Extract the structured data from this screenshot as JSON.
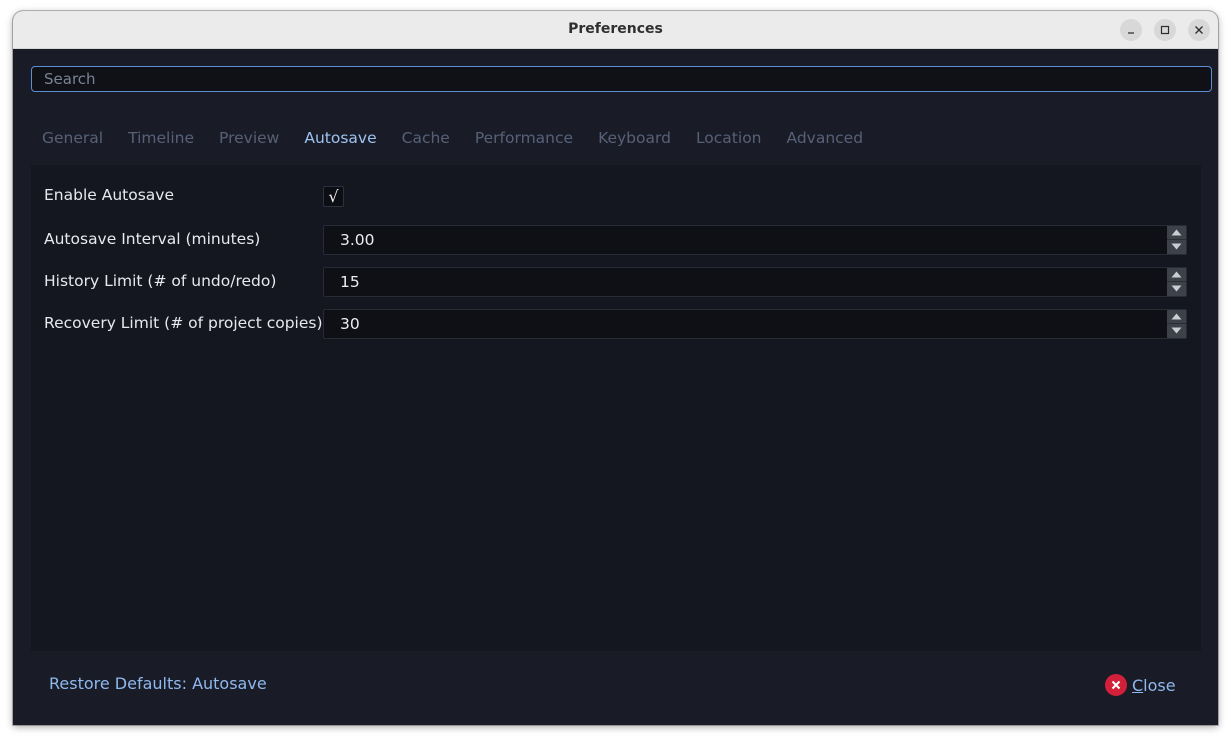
{
  "window": {
    "title": "Preferences",
    "controls": [
      "minimize-icon",
      "maximize-icon",
      "close-icon"
    ]
  },
  "search": {
    "placeholder": "Search",
    "value": ""
  },
  "tabs": [
    {
      "label": "General",
      "active": false
    },
    {
      "label": "Timeline",
      "active": false
    },
    {
      "label": "Preview",
      "active": false
    },
    {
      "label": "Autosave",
      "active": true
    },
    {
      "label": "Cache",
      "active": false
    },
    {
      "label": "Performance",
      "active": false
    },
    {
      "label": "Keyboard",
      "active": false
    },
    {
      "label": "Location",
      "active": false
    },
    {
      "label": "Advanced",
      "active": false
    }
  ],
  "settings": {
    "enable_autosave": {
      "label": "Enable Autosave",
      "checked": true,
      "check_glyph": "√"
    },
    "autosave_interval": {
      "label": "Autosave Interval (minutes)",
      "value": "3.00"
    },
    "history_limit": {
      "label": "History Limit (# of undo/redo)",
      "value": "15"
    },
    "recovery_limit": {
      "label": "Recovery Limit (# of project copies)",
      "value": "30"
    }
  },
  "footer": {
    "restore_label": "Restore Defaults: Autosave",
    "close_label_first": "C",
    "close_label_rest": "lose"
  },
  "colors": {
    "accent": "#9dc2f2",
    "link": "#8eb8ee",
    "close_icon": "#d3203a",
    "background": "#191c26"
  }
}
